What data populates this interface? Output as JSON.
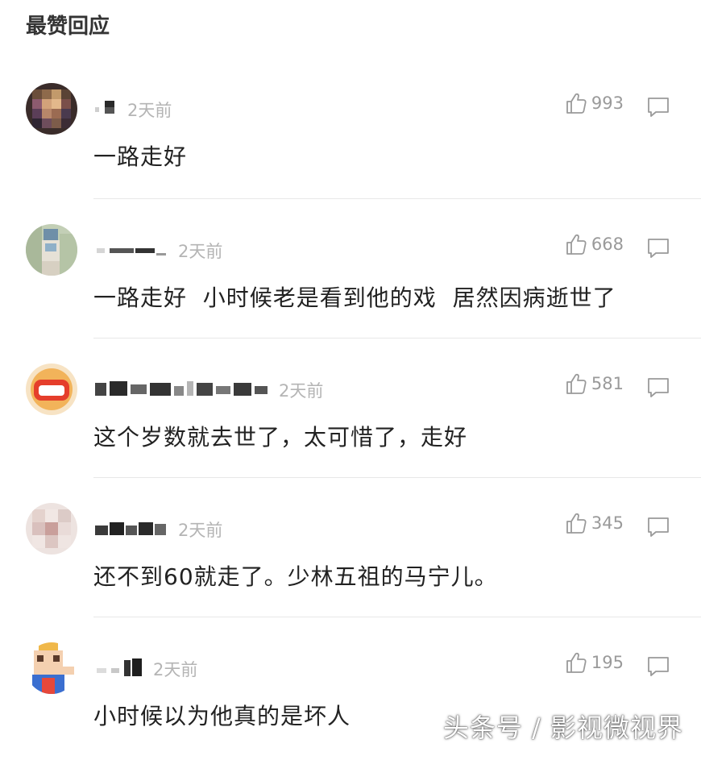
{
  "section_title": "最赞回应",
  "comments": [
    {
      "time": "2天前",
      "likes": "993",
      "text": "一路走好",
      "avatar_color": "#6b4e3a"
    },
    {
      "time": "2天前",
      "likes": "668",
      "text": "一路走好  小时候老是看到他的戏  居然因病逝世了",
      "avatar_color": "#b8c7a8"
    },
    {
      "time": "2天前",
      "likes": "581",
      "text": "这个岁数就去世了，太可惜了，走好",
      "avatar_color": "#e8502e"
    },
    {
      "time": "2天前",
      "likes": "345",
      "text": "还不到60就走了。少林五祖的马宁儿。",
      "avatar_color": "#e6d6d2"
    },
    {
      "time": "2天前",
      "likes": "195",
      "text": "小时候以为他真的是坏人",
      "avatar_color": "#f2c9a8"
    }
  ],
  "watermark": "头条号 / 影视微视界",
  "colors": {
    "muted": "#b4b4b4",
    "count": "#9a9a9a",
    "divider": "#e8e8e8"
  }
}
